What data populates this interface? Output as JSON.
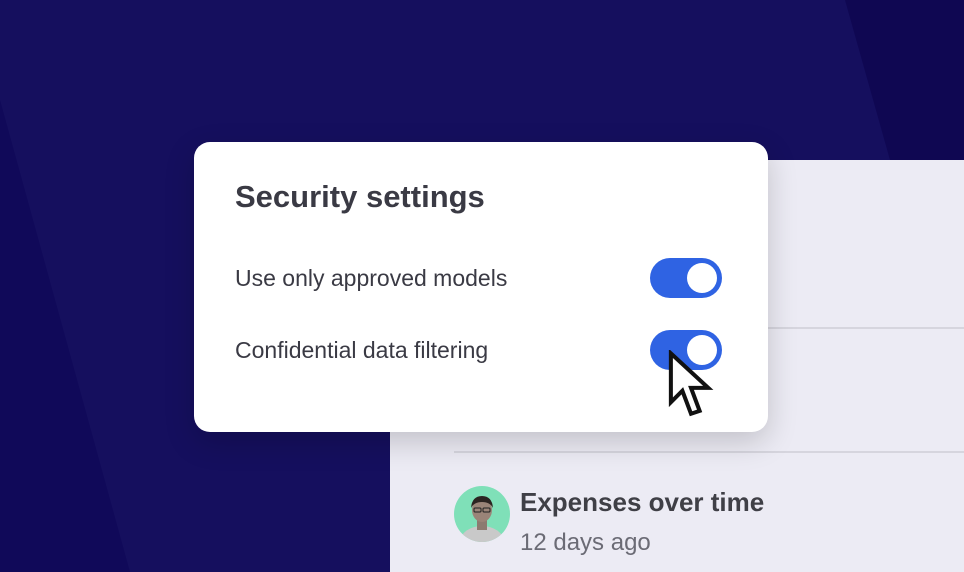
{
  "card": {
    "title": "Security settings",
    "settings": [
      {
        "label": "Use only approved models",
        "enabled": true
      },
      {
        "label": "Confidential data filtering",
        "enabled": true
      }
    ]
  },
  "activity": {
    "title": "Expenses over time",
    "time": "12 days ago"
  },
  "colors": {
    "background": "#150f5e",
    "toggle_on": "#2f63e3",
    "panel": "#ecebf4",
    "avatar_bg": "#7fe0b8"
  },
  "icons": {
    "cursor": "pointer-cursor-icon",
    "avatar": "user-avatar"
  }
}
